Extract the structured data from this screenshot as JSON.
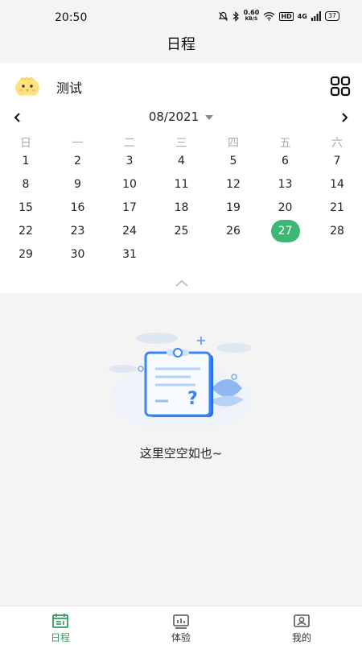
{
  "status": {
    "time": "20:50",
    "speed_value": "0.60",
    "speed_unit": "KB/S",
    "hd": "HD",
    "network": "4G",
    "battery": "37"
  },
  "header": {
    "title": "日程"
  },
  "profile": {
    "name": "测试"
  },
  "calendar": {
    "month_label": "08/2021",
    "weekdays": [
      "日",
      "一",
      "二",
      "三",
      "四",
      "五",
      "六"
    ],
    "selected_day": "27",
    "weeks": [
      [
        "1",
        "2",
        "3",
        "4",
        "5",
        "6",
        "7"
      ],
      [
        "8",
        "9",
        "10",
        "11",
        "12",
        "13",
        "14"
      ],
      [
        "15",
        "16",
        "17",
        "18",
        "19",
        "20",
        "21"
      ],
      [
        "22",
        "23",
        "24",
        "25",
        "26",
        "27",
        "28"
      ],
      [
        "29",
        "30",
        "31",
        "",
        "",
        "",
        ""
      ]
    ]
  },
  "empty_state": {
    "message": "这里空空如也~"
  },
  "tabs": [
    {
      "label": "日程",
      "icon": "schedule-icon",
      "active": true
    },
    {
      "label": "体验",
      "icon": "experience-icon",
      "active": false
    },
    {
      "label": "我的",
      "icon": "profile-icon",
      "active": false
    }
  ],
  "colors": {
    "accent": "#3cb875",
    "tab_active": "#2e9b5e",
    "background": "#f4f4f4"
  }
}
